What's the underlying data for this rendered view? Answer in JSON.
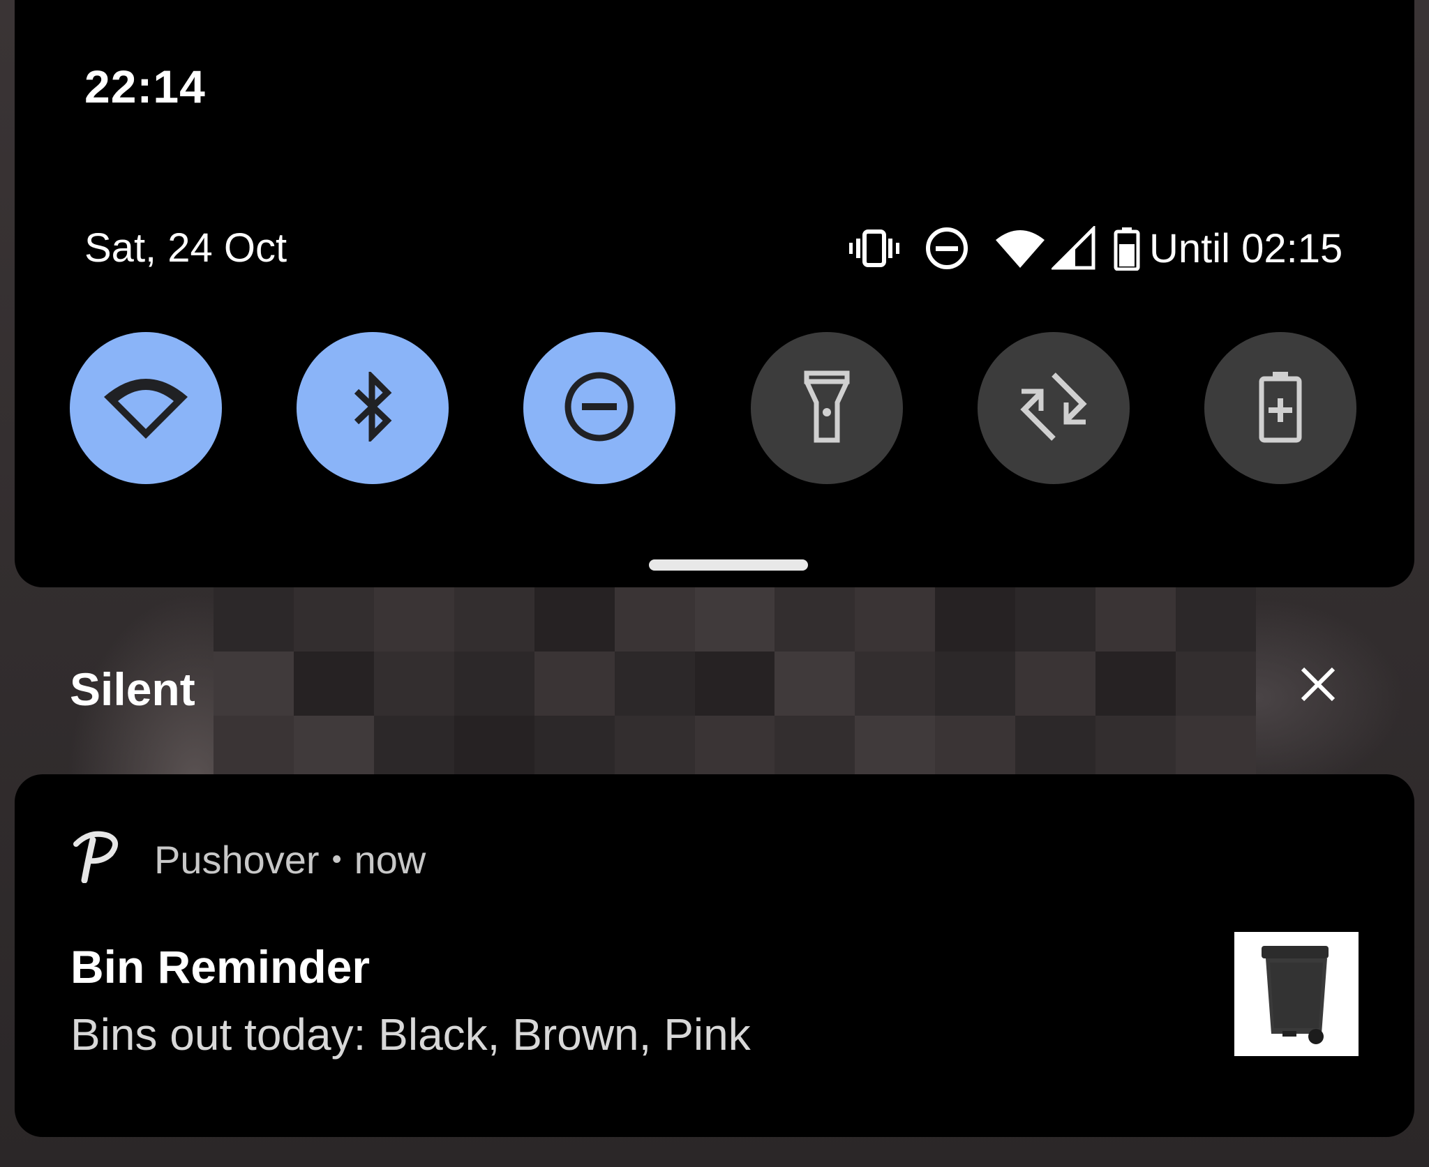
{
  "status_bar": {
    "time": "22:14"
  },
  "header": {
    "date": "Sat, 24 Oct",
    "status_icons": [
      "vibrate-icon",
      "do-not-disturb-icon",
      "wifi-icon",
      "cell-signal-icon",
      "battery-icon"
    ],
    "battery_text": "Until 02:15"
  },
  "quick_settings": {
    "tiles": [
      {
        "icon": "wifi-icon",
        "active": true
      },
      {
        "icon": "bluetooth-icon",
        "active": true
      },
      {
        "icon": "do-not-disturb-icon",
        "active": true
      },
      {
        "icon": "flashlight-icon",
        "active": false
      },
      {
        "icon": "auto-rotate-icon",
        "active": false
      },
      {
        "icon": "battery-saver-icon",
        "active": false
      }
    ],
    "active_color": "#8ab4f8",
    "inactive_color": "#3c3c3c"
  },
  "section": {
    "label": "Silent",
    "close_icon": "close-icon"
  },
  "notification": {
    "app_icon": "pushover-p-icon",
    "app_name": "Pushover",
    "separator": "•",
    "time": "now",
    "title": "Bin Reminder",
    "body": "Bins out today: Black, Brown, Pink",
    "thumbnail": "wheelie-bin-image"
  }
}
